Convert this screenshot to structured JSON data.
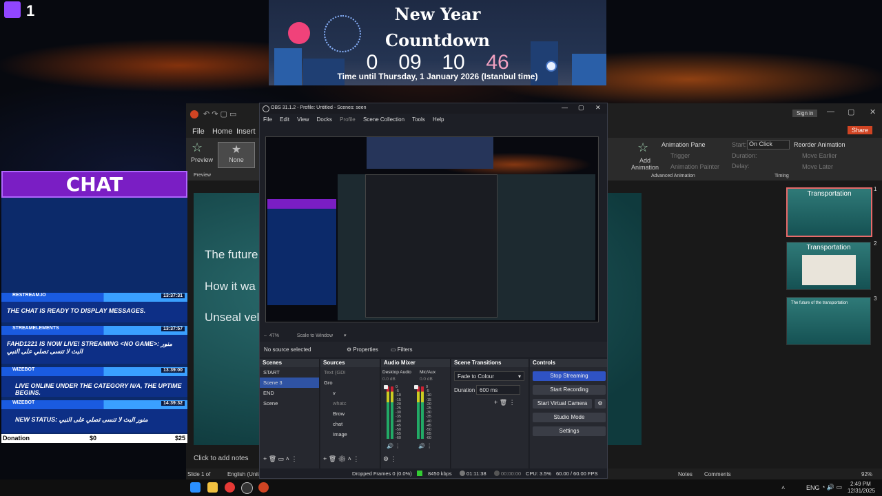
{
  "stream": {
    "viewer_count": "1"
  },
  "countdown": {
    "title_line1": "New Year",
    "title_line2": "Countdown",
    "days": "0",
    "hours": "09",
    "minutes": "10",
    "seconds": "46",
    "subtitle": "Time until Thursday, 1 January 2026 (Istanbul time)"
  },
  "chat": {
    "header": "CHAT",
    "messages": [
      {
        "user": "RESTREAM.IO",
        "time": "13:37:31",
        "text": "THE CHAT IS READY TO DISPLAY MESSAGES."
      },
      {
        "user": "STREAMELEMENTS",
        "time": "13:37:57",
        "text": "FAHD1221 IS NOW LIVE! STREAMING <NO GAME>: منور البث لا تنسى تصلي على النبي"
      },
      {
        "user": "WIZEBOT",
        "time": "13:39:00",
        "text": "LIVE ONLINE UNDER THE CATEGORY N/A, THE UPTIME BEGINS."
      },
      {
        "user": "WIZEBOT",
        "time": "14:39:32",
        "text": "NEW STATUS: منور البث لا تنسى تصلي على النبي"
      }
    ],
    "donation_label": "Donation",
    "donation_current": "$0",
    "donation_goal": "$25"
  },
  "ppt": {
    "title_sign_in": "Sign in",
    "tabs": [
      "File",
      "Home",
      "Insert"
    ],
    "share": "Share",
    "preview_label": "Preview",
    "preview_group": "Preview",
    "none_label": "None",
    "animation_pane": "Animation Pane",
    "trigger": "Trigger",
    "animation_painter": "Animation Painter",
    "add_animation": "Add Animation",
    "advanced_animation": "Advanced Animation",
    "start_label": "Start:",
    "start_value": "On Click",
    "duration_label": "Duration:",
    "delay_label": "Delay:",
    "reorder": "Reorder Animation",
    "move_earlier": "Move Earlier",
    "move_later": "Move Later",
    "timing": "Timing",
    "slide_lines": [
      "The future",
      "How it wa",
      "Unseal vel"
    ],
    "notes_placeholder": "Click to add notes",
    "status_slide": "Slide 1 of",
    "status_lang": "English (Unite",
    "status_notes": "Notes",
    "status_comments": "Comments",
    "zoom": "92%",
    "thumbs": [
      {
        "num": "1",
        "title": "Transportation"
      },
      {
        "num": "2",
        "title": "Transportation"
      },
      {
        "num": "3",
        "title": "The future of the transportation"
      }
    ]
  },
  "obs": {
    "title": "OBS 31.1.2 - Profile: Untitled - Scenes: seen",
    "menu": [
      "File",
      "Edit",
      "View",
      "Docks",
      "Profile",
      "Scene Collection",
      "Tools",
      "Help"
    ],
    "zoom": "47%",
    "scale_mode": "Scale to Window",
    "no_source": "No source selected",
    "properties": "Properties",
    "filters": "Filters",
    "docks": {
      "scenes": "Scenes",
      "sources": "Sources",
      "mixer": "Audio Mixer",
      "transitions": "Scene Transitions",
      "controls": "Controls"
    },
    "scenes": [
      "START",
      "Scene 3",
      "END",
      "Scene"
    ],
    "sources": [
      "Text (GDI",
      "Gro",
      "v",
      "whatc",
      "Brow",
      "chat",
      "Image"
    ],
    "mixer": {
      "desktop": "Desktop Audio",
      "desktop_db": "0.0 dB",
      "mic": "Mic/Aux",
      "mic_db": "0.0 dB",
      "scale": [
        "0",
        "-5",
        "-10",
        "-15",
        "-20",
        "-25",
        "-30",
        "-35",
        "-40",
        "-45",
        "-50",
        "-55",
        "-60"
      ]
    },
    "transitions": {
      "type": "Fade to Colour",
      "duration_label": "Duration",
      "duration": "600 ms"
    },
    "controls": [
      "Stop Streaming",
      "Start Recording",
      "Start Virtual Camera",
      "Studio Mode",
      "Settings"
    ],
    "status": {
      "dropped": "Dropped Frames 0 (0.0%)",
      "bitrate": "8450 kbps",
      "live_time": "01:11:38",
      "rec_time": "00:00:00",
      "cpu": "CPU: 3.5%",
      "fps": "60.00 / 60.00 FPS"
    }
  },
  "taskbar": {
    "lang": "ENG",
    "time": "2:49 PM",
    "date": "12/31/2025"
  }
}
